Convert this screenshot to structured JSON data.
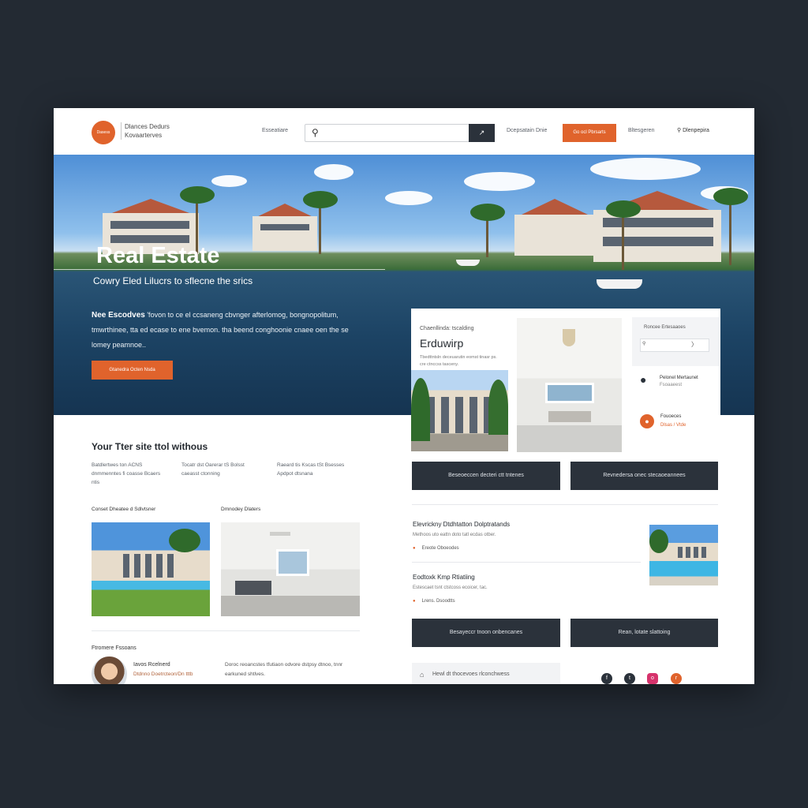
{
  "header": {
    "logo_text": "Dasess",
    "brand_line1": "Dlances Dedurs",
    "brand_line2": "Kovaarterves",
    "nav_left": "Esseatiare",
    "search_placeholder": "",
    "search_btn_icon": "arrow-icon",
    "nav_right1": "Dcepsatain Dnie",
    "cta": "Go ocl Pbrsarts",
    "nav_right2": "Bltesgeren",
    "nav_right3": "Dlenpepira"
  },
  "hero": {
    "title": "Real Estate",
    "subtitle": "Cowry Eled Lilucrs to sflecne the srics",
    "body_lead": "Nee Escodves",
    "body": "'fovon to ce el ccsaneng cbvnger afterlomog, bongnopolitum, tmwrthinee, tta ed ecase to ene bvemon. tha beend conghoonie cnaee oen the se lomey peamnoe..",
    "button": "Gtanedra Octen Nsda"
  },
  "features": {
    "title": "Your Tter site ttol withous",
    "cols": [
      "Batdlertwes ton ACNS dnmmenntes fi coasse Bcaers ntis",
      "Tocatr dst Oarerar tS Bolsst caeasst ctonning",
      "Raeard tis Kscas tSt Bsesses Apdpot dtsnana"
    ]
  },
  "gallery": {
    "label1": "Conset Dheatee d Sdlvtsner",
    "label2": "Dmnodey Dlaters"
  },
  "agent": {
    "section": "Ftromere Fssoans",
    "name": "Iavos Rcelnerd",
    "role": "Dtdnno Doetrcteon/Dn tttb",
    "text": "Doroc reoancstes tfutiaon odvore dstpsy dtnoo, tnnr earkuned shtlves."
  },
  "card": {
    "kicker": "Chaenllinda: tscalding",
    "title": "Erduwirp",
    "text": "Tbedttntsln deceuarutin eomst tinasr ps. cre ctnccss tasceny."
  },
  "sidebar": {
    "form_label": "Roncee Ertesaaoes",
    "agent_name": "Pelonel Mertaunet",
    "agent_role": "Fsoaaeest",
    "contact_title": "Fouoeces",
    "contact_sub": "Dlsas / Vtde"
  },
  "buttons": {
    "b1": "Beseoeccen decteri ctt tntenes",
    "b2": "Revnedersa onec stecaoeannees",
    "b3": "Besayeccr tnoon onbencanes",
    "b4": "Rean, lotate slattoing"
  },
  "listings": [
    {
      "title": "Elevrickny Dtdhtatton Dolptratands",
      "sub": "Methoos uto eattn doto tatl ecdas otber.",
      "loc": "Ereote Oboeodes"
    },
    {
      "title": "Eodtoxk Kmp Rtiatiing",
      "sub": "Estescaet tsnt ctstcoss ecoicer, tac.",
      "loc": "Lrens. Dsoodtts"
    }
  ],
  "footer": {
    "box": "Hewl dt thocevoes rlconchwess",
    "social": [
      "facebook-icon",
      "twitter-icon",
      "instagram-icon",
      "rss-icon"
    ]
  },
  "colors": {
    "accent": "#e0632c",
    "dark": "#2b323b",
    "background": "#232a33"
  }
}
